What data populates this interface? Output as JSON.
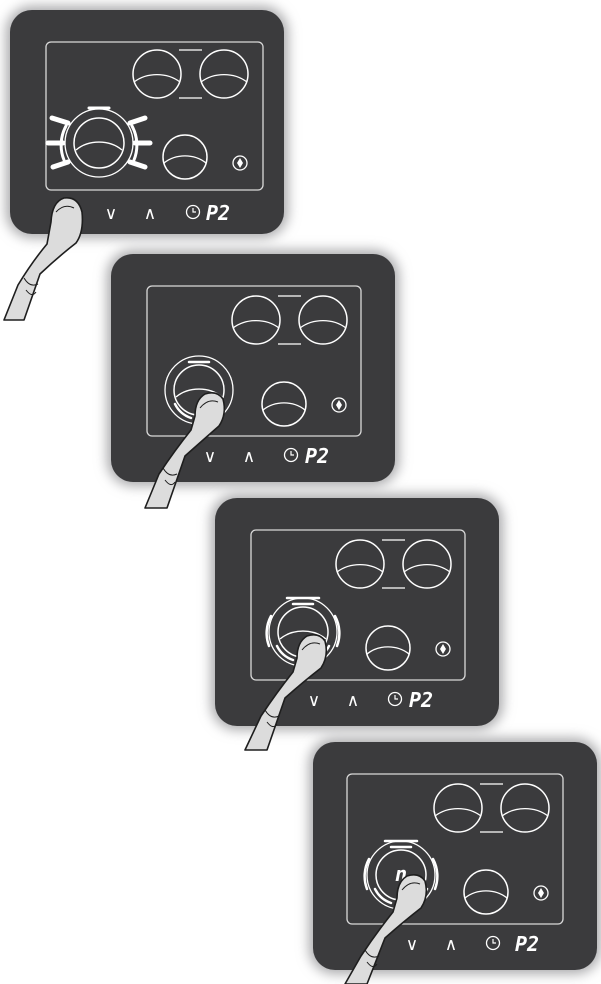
{
  "colors": {
    "panel": "#3b3b3d",
    "panel_glow": "#a9a9ab",
    "line": "#d9d9d9",
    "light": "#ffffff",
    "finger": "#dcdcdc",
    "finger_outline": "#1e1e1e"
  },
  "controls": {
    "down_label": "∨",
    "up_label": "∧",
    "program_label": "P2"
  },
  "steps": [
    {
      "zone_display": ""
    },
    {
      "zone_display": ""
    },
    {
      "zone_display": ""
    },
    {
      "zone_display": "n"
    }
  ],
  "icons": {
    "timer": "clock-icon",
    "lock": "key-lock-icon"
  }
}
